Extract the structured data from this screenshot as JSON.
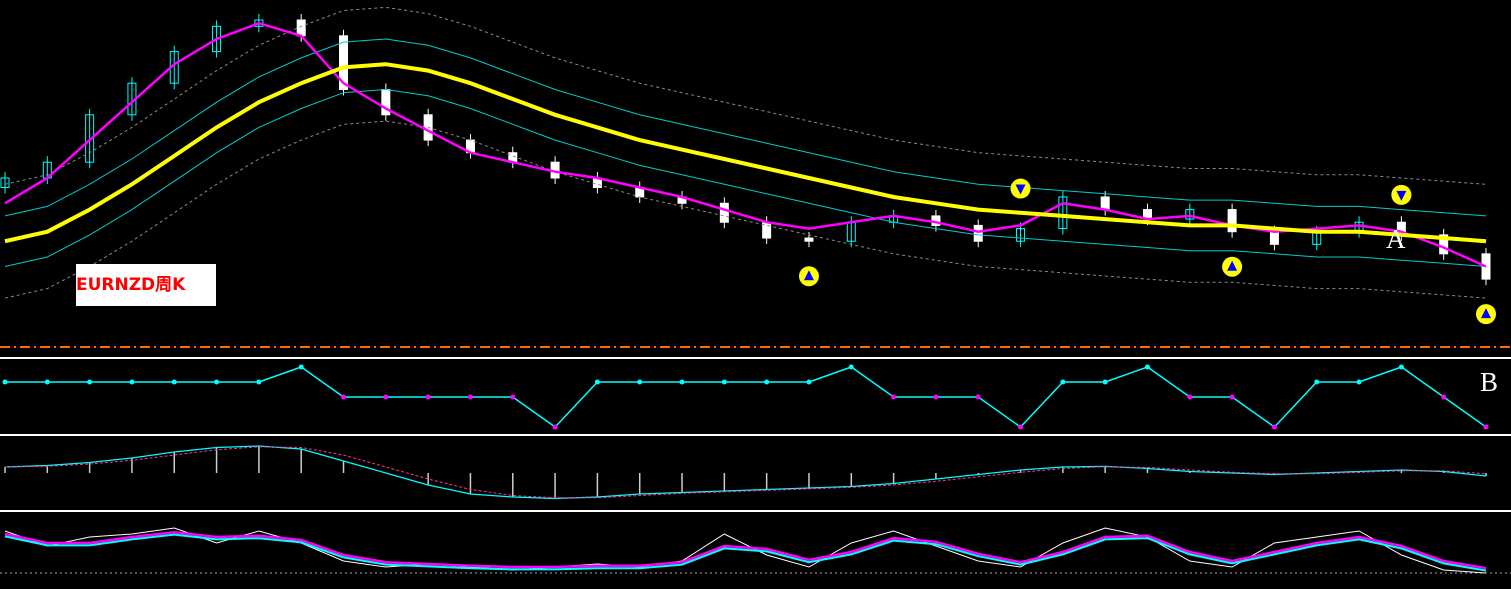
{
  "chart_title": "EURNZD周K",
  "annotations": {
    "a": "A",
    "b": "B"
  },
  "colors": {
    "background": "#000000",
    "bullish_candle": "#00ffff",
    "bearish_candle": "#ffffff",
    "moving_average_slow": "#ffff00",
    "moving_average_fast": "#ff00ff",
    "band": "#00cccc",
    "envelope": "#8a8a8a",
    "support_line": "#ff6a00",
    "up_arrow": "#0000ff",
    "down_arrow": "#0000ff",
    "circle_signal": "#ff8c00",
    "pink_signal": "#ff3399",
    "panel_border": "#ffffff"
  },
  "chart_data": [
    {
      "type": "candlestick",
      "panel": "price",
      "series": [
        {
          "name": "",
          "kind": "ma_slow",
          "values": [
            0.3,
            0.33,
            0.4,
            0.48,
            0.57,
            0.66,
            0.74,
            0.8,
            0.85,
            0.86,
            0.84,
            0.8,
            0.75,
            0.7,
            0.66,
            0.62,
            0.59,
            0.56,
            0.53,
            0.5,
            0.47,
            0.44,
            0.42,
            0.4,
            0.39,
            0.38,
            0.37,
            0.36,
            0.35,
            0.35,
            0.34,
            0.33,
            0.33,
            0.32,
            0.31,
            0.3
          ]
        },
        {
          "name": "",
          "kind": "ma_fast",
          "values": [
            0.42,
            0.5,
            0.62,
            0.74,
            0.86,
            0.94,
            0.99,
            0.95,
            0.8,
            0.72,
            0.65,
            0.58,
            0.55,
            0.52,
            0.5,
            0.47,
            0.44,
            0.4,
            0.36,
            0.34,
            0.36,
            0.38,
            0.36,
            0.33,
            0.35,
            0.42,
            0.4,
            0.37,
            0.38,
            0.35,
            0.33,
            0.34,
            0.35,
            0.33,
            0.28,
            0.22
          ]
        }
      ],
      "close": [
        0.5,
        0.55,
        0.7,
        0.8,
        0.9,
        0.98,
        1.0,
        0.95,
        0.78,
        0.7,
        0.62,
        0.58,
        0.55,
        0.5,
        0.47,
        0.44,
        0.42,
        0.36,
        0.31,
        0.3,
        0.36,
        0.38,
        0.35,
        0.3,
        0.34,
        0.44,
        0.4,
        0.37,
        0.4,
        0.33,
        0.29,
        0.33,
        0.36,
        0.32,
        0.26,
        0.18
      ],
      "ylim": [
        0,
        1
      ]
    },
    {
      "type": "line",
      "panel": "B",
      "series": [
        {
          "name": "",
          "values": [
            1,
            1,
            1,
            1,
            1,
            1,
            1,
            2,
            0,
            0,
            0,
            0,
            0,
            -2,
            1,
            1,
            1,
            1,
            1,
            1,
            2,
            0,
            0,
            0,
            -2,
            1,
            1,
            2,
            0,
            0,
            -2,
            1,
            1,
            2,
            0,
            -2
          ]
        }
      ],
      "ylim": [
        -2,
        2
      ]
    },
    {
      "type": "line",
      "panel": "macd",
      "series": [
        {
          "name": "",
          "values": [
            0.2,
            0.25,
            0.35,
            0.5,
            0.7,
            0.85,
            0.9,
            0.8,
            0.4,
            0.0,
            -0.4,
            -0.7,
            -0.8,
            -0.85,
            -0.8,
            -0.7,
            -0.65,
            -0.6,
            -0.55,
            -0.5,
            -0.45,
            -0.35,
            -0.2,
            -0.05,
            0.1,
            0.2,
            0.22,
            0.15,
            0.05,
            0.0,
            -0.05,
            0.0,
            0.05,
            0.1,
            0.05,
            -0.1
          ]
        }
      ],
      "ylim": [
        -1,
        1
      ]
    },
    {
      "type": "line",
      "panel": "stochastic",
      "series": [
        {
          "name": "",
          "values": [
            80,
            55,
            70,
            75,
            85,
            60,
            80,
            60,
            30,
            20,
            25,
            20,
            15,
            20,
            25,
            20,
            30,
            75,
            40,
            20,
            60,
            80,
            55,
            30,
            20,
            60,
            85,
            70,
            30,
            20,
            60,
            70,
            80,
            40,
            15,
            10
          ]
        },
        {
          "name": "",
          "values": [
            75,
            60,
            60,
            70,
            78,
            70,
            72,
            65,
            40,
            28,
            25,
            22,
            20,
            20,
            22,
            22,
            28,
            55,
            50,
            32,
            45,
            68,
            62,
            42,
            28,
            45,
            70,
            72,
            45,
            30,
            45,
            60,
            70,
            55,
            30,
            18
          ]
        }
      ],
      "ylim": [
        0,
        100
      ]
    }
  ]
}
